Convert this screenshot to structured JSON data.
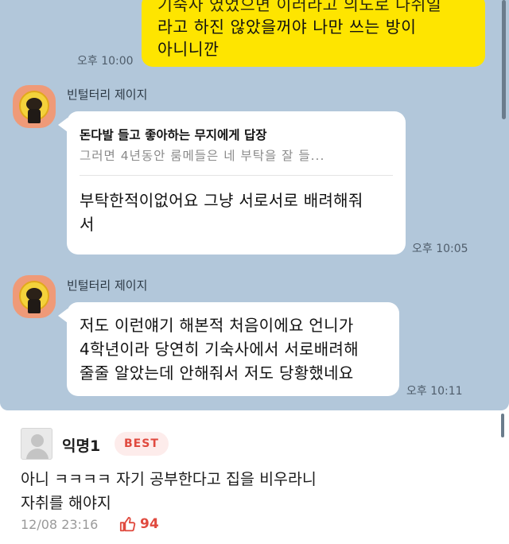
{
  "chat": {
    "my_message": {
      "clipped_line": "기숙사 였었으면 이러라고 의도로 나쉬일",
      "line1": "라고 하진 않았을꺼야 나만 쓰는 방이",
      "line2": "아니니깐",
      "time": "오후 10:00"
    },
    "message_1": {
      "sender": "빈털터리 제이지",
      "reply_header": "돈다발 들고 좋아하는 무지에게 답장",
      "reply_quote": "그러면 4년동안 룸메들은 네 부탁을 잘 들...",
      "line1": "부탁한적이없어요 그냥 서로서로 배려해줘",
      "line2": "서",
      "time": "오후 10:05"
    },
    "message_2": {
      "sender": "빈털터리 제이지",
      "line1": "저도 이런얘기 해본적 처음이에요 언니가",
      "line2": "4학년이라 당연히 기숙사에서 서로배려해",
      "line3": "줄줄 알았는데 안해줘서 저도 당황했네요",
      "time": "오후 10:11"
    }
  },
  "comment": {
    "username": "익명1",
    "badge": "BEST",
    "text_line1": "아니 ㅋㅋㅋㅋ 자기 공부한다고 집을 비우라니",
    "text_line2": "자취를 해야지",
    "date": "12/08 23:16",
    "likes": "94",
    "like_icon": "thumbs-up-icon"
  },
  "colors": {
    "chat_background": "#b2c7da",
    "my_bubble": "#fee500",
    "best_badge_text": "#e04a3f",
    "best_badge_bg": "#fdeceb"
  }
}
